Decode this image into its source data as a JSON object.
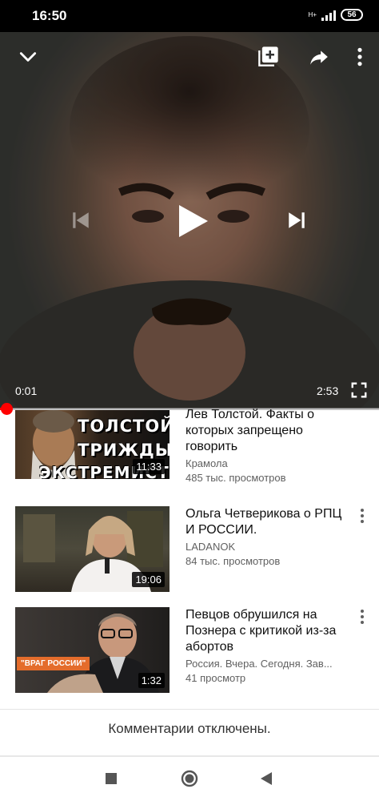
{
  "status_bar": {
    "time": "16:50",
    "network": "H+",
    "battery": "56"
  },
  "player": {
    "current_time": "0:01",
    "total_time": "2:53",
    "progress_fraction": 0.006,
    "icons": {
      "minimize": "chevron-down-icon",
      "add_to_playlist": "playlist-add-icon",
      "share": "share-icon",
      "more": "more-vert-icon",
      "previous": "skip-previous-icon",
      "play": "play-icon",
      "next": "skip-next-icon",
      "fullscreen": "fullscreen-icon"
    }
  },
  "videos": [
    {
      "title": "Лев Толстой. Факты о которых запрещено говорить",
      "channel": "Крамола",
      "views": "485 тыс. просмотров",
      "duration": "11:33",
      "thumb_lines": [
        "ТОЛСТОЙ",
        "ТРИЖДЫ",
        "ЭКСТРЕМИСТ"
      ]
    },
    {
      "title": "Ольга Четверикова о РПЦ И РОССИИ.",
      "channel": "LADANOK",
      "views": "84 тыс. просмотров",
      "duration": "19:06"
    },
    {
      "title": "Певцов обрушился на Познера с критикой из-за абортов",
      "channel": "Россия. Вчера. Сегодня. Зав...",
      "views": "41 просмотр",
      "duration": "1:32",
      "thumb_badge": "\"ВРАГ РОССИИ\""
    }
  ],
  "comments_notice": "Комментарии отключены.",
  "colors": {
    "accent": "#ff0000",
    "text_primary": "#0f0f0f",
    "text_secondary": "#606060"
  }
}
